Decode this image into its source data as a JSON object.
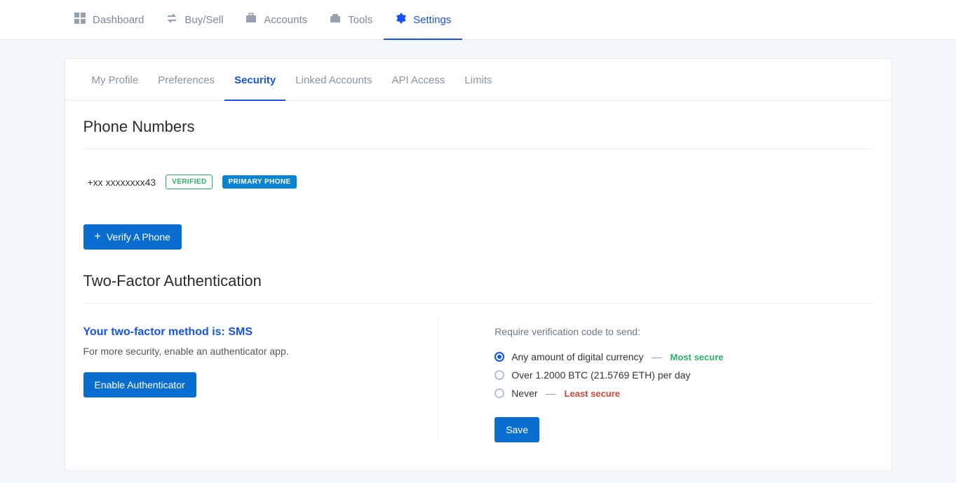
{
  "topnav": {
    "items": [
      {
        "label": "Dashboard",
        "icon": "dashboard",
        "active": false
      },
      {
        "label": "Buy/Sell",
        "icon": "swap",
        "active": false
      },
      {
        "label": "Accounts",
        "icon": "briefcase",
        "active": false
      },
      {
        "label": "Tools",
        "icon": "toolbox",
        "active": false
      },
      {
        "label": "Settings",
        "icon": "gear",
        "active": true
      }
    ]
  },
  "subtabs": [
    {
      "label": "My Profile",
      "active": false
    },
    {
      "label": "Preferences",
      "active": false
    },
    {
      "label": "Security",
      "active": true
    },
    {
      "label": "Linked Accounts",
      "active": false
    },
    {
      "label": "API Access",
      "active": false
    },
    {
      "label": "Limits",
      "active": false
    }
  ],
  "phone_section": {
    "title": "Phone Numbers",
    "number": "+xx xxxxxxxx43",
    "verified_badge": "VERIFIED",
    "primary_badge": "PRIMARY PHONE",
    "verify_button": "Verify A Phone"
  },
  "tfa_section": {
    "title": "Two-Factor Authentication",
    "method_heading": "Your two-factor method is: SMS",
    "method_sub": "For more security, enable an authenticator app.",
    "enable_button": "Enable Authenticator",
    "require_label": "Require verification code to send:",
    "options": [
      {
        "label": "Any amount of digital currency",
        "tag": "Most secure",
        "tag_class": "tag-green",
        "selected": true
      },
      {
        "label": "Over 1.2000 BTC (21.5769 ETH) per day",
        "tag": "",
        "tag_class": "",
        "selected": false
      },
      {
        "label": "Never",
        "tag": "Least secure",
        "tag_class": "tag-red",
        "selected": false
      }
    ],
    "save_button": "Save"
  }
}
